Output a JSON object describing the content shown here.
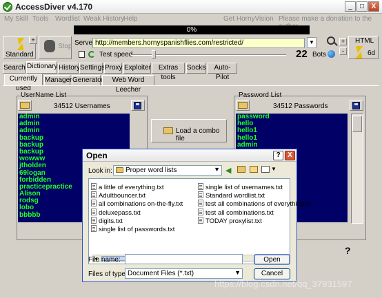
{
  "window": {
    "title": "AccessDiver v4.170",
    "min": "_",
    "max": "□",
    "close": "X"
  },
  "menu": {
    "items": [
      "My Skill",
      "Tools",
      "Wordlist",
      "Weak History",
      "Help"
    ],
    "center": "Get HornyVision",
    "right": "Please make a donation to the author"
  },
  "progress": {
    "label": "0%",
    "value": 0
  },
  "toolbar": {
    "standard_label": "Standard",
    "stop_label": "Stop",
    "server_label": "Server",
    "server_value": "http://members.hornyspanishflies.com/restricted/",
    "test_speed_label": "Test speed",
    "bots_value": "22",
    "bots_label": "Bots",
    "html_label": "HTML",
    "sixd_label": "6d",
    "plus": "+",
    "minus": "-"
  },
  "tabs": [
    "Search",
    "Dictionary",
    "History",
    "Settings",
    "Proxy",
    "Exploiter",
    "Extras tools",
    "Socks",
    "Auto-Pilot"
  ],
  "subtabs": [
    "Currently used",
    "Manager",
    "Generator",
    "Web Word Leecher"
  ],
  "usernames": {
    "title": "UserName List",
    "count": "34512 Usernames",
    "items": [
      "admin",
      "admin",
      "admin",
      "backup",
      "backup",
      "backup",
      "wowww",
      "jtholden",
      "69logan",
      "forbidden",
      "practicepractice",
      "Alison",
      "rodsg",
      "lobo",
      "bbbbb"
    ]
  },
  "combo": {
    "label": "Load a combo file"
  },
  "passwords": {
    "title": "Password List",
    "count": "34512 Passwords",
    "items": [
      "password",
      "hello",
      "hello1",
      "hello1",
      "admin"
    ]
  },
  "help_mark": "?",
  "dialog": {
    "title": "Open",
    "help": "?",
    "close": "X",
    "look_in_label": "Look in:",
    "look_in_value": "Proper word lists",
    "files_left": [
      "a little of everything.txt",
      "Adultbouncer.txt",
      "all combinations on-the-fly.txt",
      "deluxepass.txt",
      "digits.txt",
      "single list of passwords.txt"
    ],
    "files_right": [
      "single list of usernames.txt",
      "Standard wordlist.txt",
      "test all combinations of everything.tx",
      "test all combinations.txt",
      "TODAY proxylist.txt"
    ],
    "file_name_label": "File name:",
    "file_name_value": "",
    "files_of_type_label": "Files of type:",
    "files_of_type_value": "Document Files (*.txt)",
    "open_label": "Open",
    "cancel_label": "Cancel"
  },
  "watermark": "https://blog.csdn.net/qq_37931597"
}
